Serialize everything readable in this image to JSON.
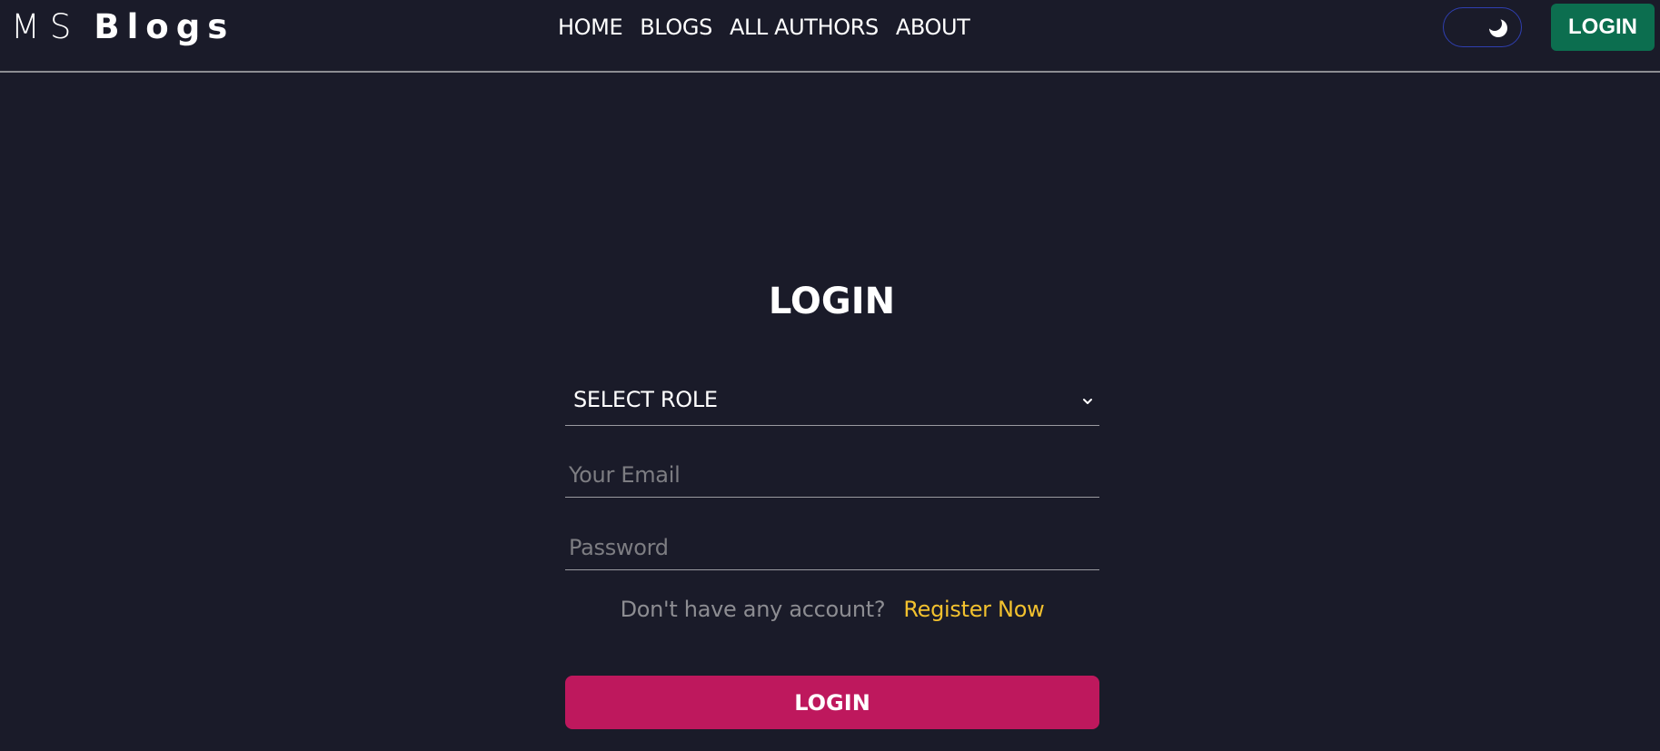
{
  "brand": {
    "part1": "MS",
    "part2": "Blogs"
  },
  "nav": {
    "items": [
      {
        "label": "HOME"
      },
      {
        "label": "BLOGS"
      },
      {
        "label": "ALL AUTHORS"
      },
      {
        "label": "ABOUT"
      }
    ]
  },
  "header": {
    "theme_toggle_icon": "moon-icon",
    "login_label": "LOGIN"
  },
  "form": {
    "title": "LOGIN",
    "role_select": {
      "selected": "SELECT ROLE",
      "icon": "chevron-down-icon"
    },
    "email": {
      "placeholder": "Your Email",
      "value": ""
    },
    "password": {
      "placeholder": "Password",
      "value": ""
    },
    "register_prompt": "Don't have any account?",
    "register_link": "Register Now",
    "submit_label": "LOGIN"
  },
  "colors": {
    "background": "#1a1b29",
    "header_login_bg": "#0c6e4f",
    "submit_bg": "#be185d",
    "link": "#f2c12e"
  }
}
